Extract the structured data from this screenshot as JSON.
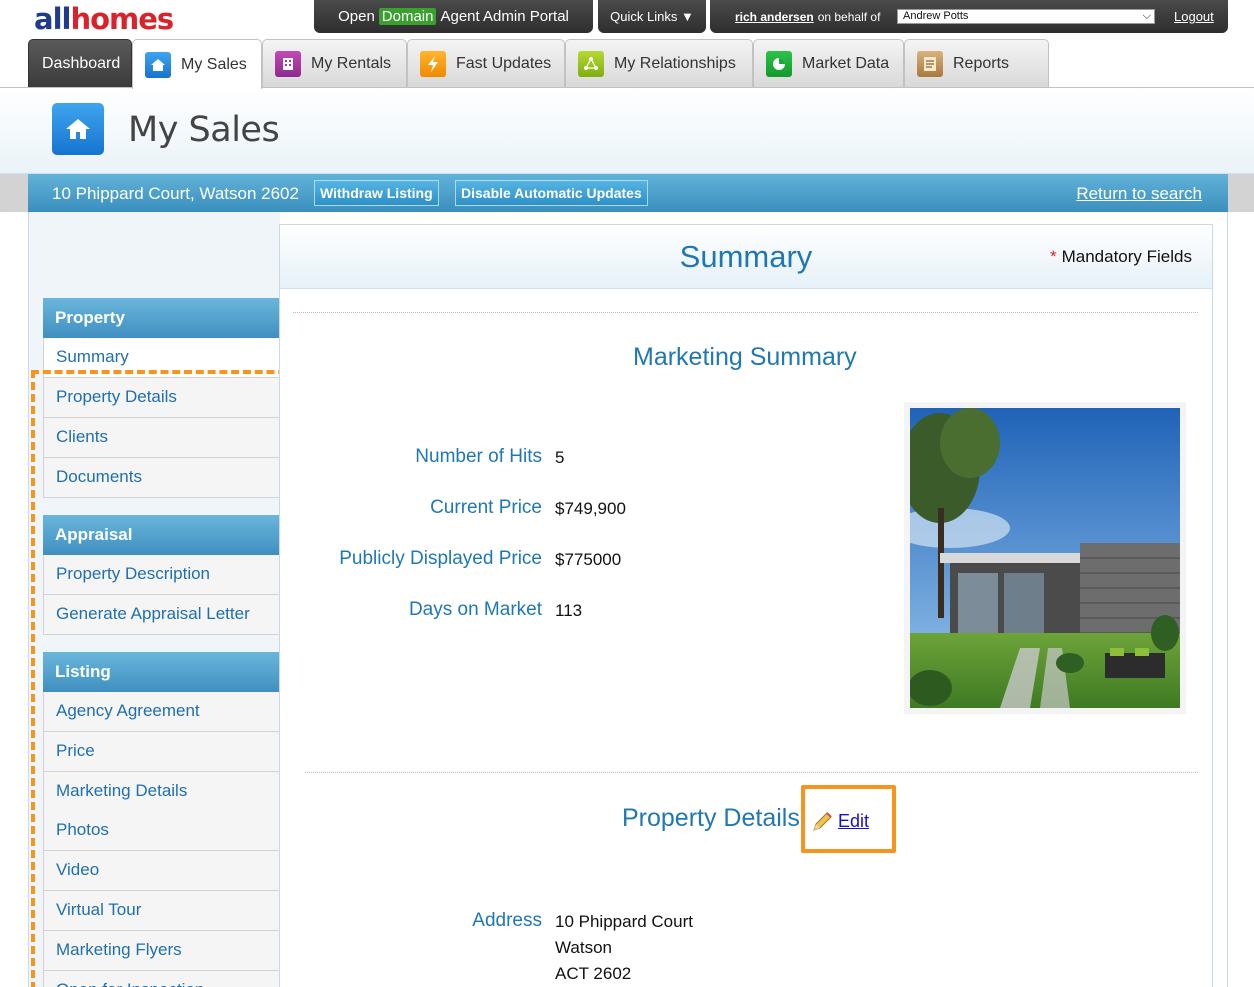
{
  "brand": {
    "logo_part1": "all",
    "logo_part2": "homes"
  },
  "topnav": {
    "portal_pre": "Open",
    "portal_domain": "Domain",
    "portal_post": "Agent Admin Portal",
    "quick_links": "Quick Links ▼",
    "user_name": "rich andersen",
    "behalf_text": "on behalf of",
    "agent_selected": "Andrew Potts",
    "logout": "Logout"
  },
  "tabs": [
    {
      "label": "Dashboard"
    },
    {
      "label": "My Sales"
    },
    {
      "label": "My Rentals"
    },
    {
      "label": "Fast Updates"
    },
    {
      "label": "My Relationships"
    },
    {
      "label": "Market Data"
    },
    {
      "label": "Reports"
    }
  ],
  "page": {
    "title": "My Sales"
  },
  "address_bar": {
    "address": "10 Phippard Court, Watson 2602",
    "withdraw": "Withdraw Listing",
    "disable_updates": "Disable Automatic Updates",
    "return_search": "Return to search"
  },
  "sidebar": {
    "property_head": "Property",
    "property_items": [
      "Summary",
      "Property Details",
      "Clients",
      "Documents"
    ],
    "appraisal_head": "Appraisal",
    "appraisal_items": [
      "Property Description",
      "Generate Appraisal Letter"
    ],
    "listing_head": "Listing",
    "listing_items": [
      "Agency Agreement",
      "Price",
      "Marketing Details",
      "Photos",
      "Video",
      "Virtual Tour",
      "Marketing Flyers",
      "Open for Inspection"
    ]
  },
  "summary": {
    "title": "Summary",
    "mandatory_star": "*",
    "mandatory": "Mandatory Fields",
    "marketing_title": "Marketing Summary",
    "fields": [
      {
        "label": "Number of Hits",
        "value": "5"
      },
      {
        "label": "Current Price",
        "value": "$749,900"
      },
      {
        "label": "Publicly Displayed Price",
        "value": "$775000"
      },
      {
        "label": "Days on Market",
        "value": "113"
      }
    ],
    "property_details_title": "Property Details",
    "edit": "Edit",
    "address_label": "Address",
    "address_lines": [
      "10 Phippard Court",
      "Watson",
      "ACT 2602"
    ]
  },
  "colors": {
    "accent_blue": "#1f78b4",
    "highlight_orange": "#f7941d",
    "bar_blue": "#3a8fbe"
  }
}
